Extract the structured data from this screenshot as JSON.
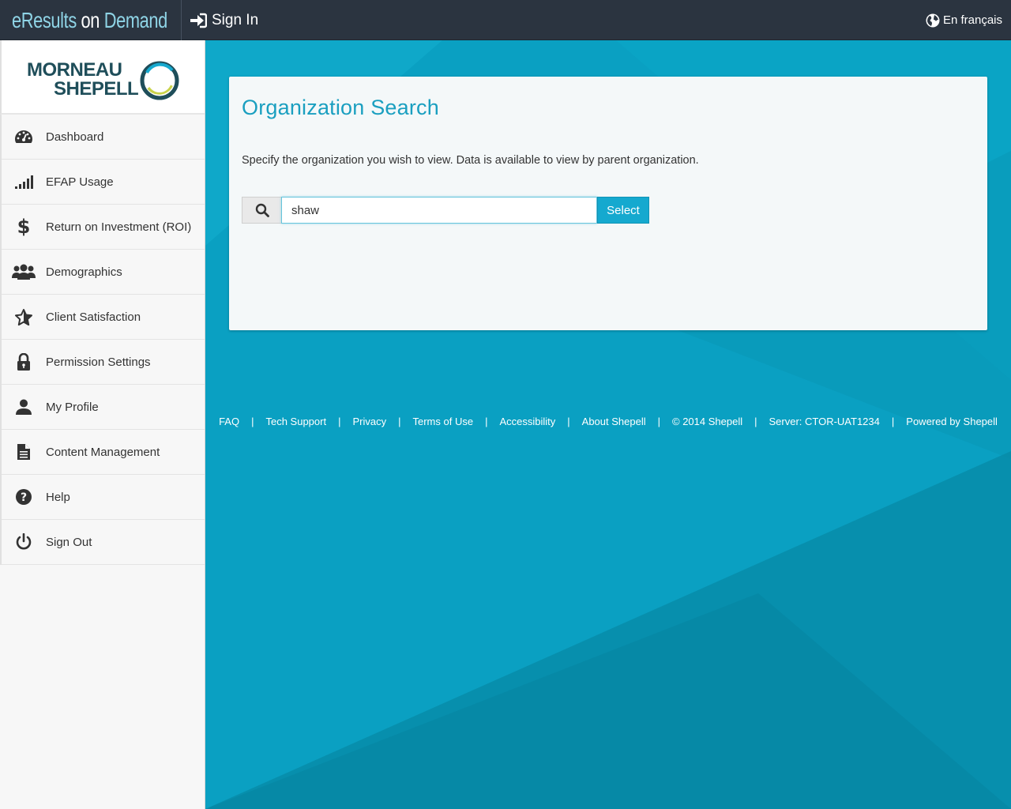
{
  "header": {
    "brand_e": "eResults",
    "brand_on": " on ",
    "brand_demand": "Demand",
    "signin_label": "Sign In",
    "lang_label": "En français"
  },
  "logo": {
    "line1": "MORNEAU",
    "line2": "SHEPELL"
  },
  "sidebar": {
    "items": [
      {
        "label": "Dashboard",
        "icon": "dashboard-icon"
      },
      {
        "label": "EFAP Usage",
        "icon": "signal-bars-icon"
      },
      {
        "label": "Return on Investment (ROI)",
        "icon": "dollar-icon"
      },
      {
        "label": "Demographics",
        "icon": "users-icon"
      },
      {
        "label": "Client Satisfaction",
        "icon": "star-icon"
      },
      {
        "label": "Permission Settings",
        "icon": "lock-icon"
      },
      {
        "label": "My Profile",
        "icon": "user-icon"
      },
      {
        "label": "Content Management",
        "icon": "document-icon"
      },
      {
        "label": "Help",
        "icon": "question-icon"
      },
      {
        "label": "Sign Out",
        "icon": "power-icon"
      }
    ]
  },
  "main": {
    "title": "Organization Search",
    "description": "Specify the organization you wish to view. Data is available to view by parent organization.",
    "search_value": "shaw",
    "select_label": "Select"
  },
  "footer": {
    "links": [
      "FAQ",
      "Tech Support",
      "Privacy",
      "Terms of Use",
      "Accessibility",
      "About Shepell",
      "© 2014 Shepell",
      "Server: CTOR-UAT1234",
      "Powered by Shepell"
    ],
    "separator": "|"
  },
  "colors": {
    "topbar": "#2b3440",
    "accent": "#1a9fc0",
    "background": "#0a9bbd",
    "button": "#15a9cf"
  }
}
